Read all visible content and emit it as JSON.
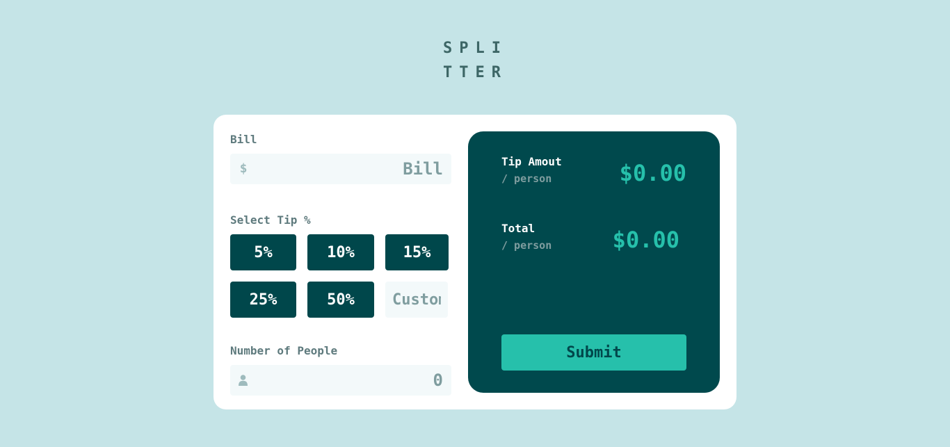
{
  "app": {
    "logo_line1": "SPLI",
    "logo_line2": "TTER"
  },
  "form": {
    "bill_label": "Bill",
    "bill_placeholder": "Bill",
    "bill_icon": "dollar-icon",
    "bill_icon_text": "$",
    "tip_label": "Select Tip %",
    "tip_options": [
      "5%",
      "10%",
      "15%",
      "25%",
      "50%"
    ],
    "custom_placeholder": "Custom",
    "people_label": "Number of People",
    "people_placeholder": "0",
    "people_icon": "person-icon"
  },
  "results": {
    "tip_label": "Tip Amout",
    "tip_sub": "/ person",
    "tip_amount": "$0.00",
    "total_label": "Total",
    "total_sub": "/ person",
    "total_amount": "$0.00",
    "submit_label": "Submit"
  },
  "colors": {
    "background": "#c5e4e7",
    "dark_cyan": "#00474b",
    "strong_cyan": "#26c0ab",
    "grayish_cyan": "#7f9d9f",
    "input_bg": "#f3f9fa"
  }
}
